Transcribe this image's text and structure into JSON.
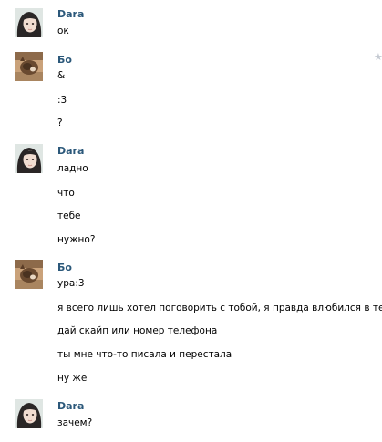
{
  "messages": [
    {
      "author": "Dara",
      "avatar": "girl-avatar-icon",
      "lines": [
        "ок"
      ]
    },
    {
      "author": "Бо",
      "avatar": "cat-avatar-icon",
      "lines": [
        "&",
        ":3",
        "?"
      ]
    },
    {
      "author": "Dara",
      "avatar": "girl-avatar-icon",
      "lines": [
        "ладно",
        "что",
        "тебе",
        "нужно?"
      ]
    },
    {
      "author": "Бо",
      "avatar": "cat-avatar-icon",
      "lines": [
        "ура:3",
        "я всего лишь хотел поговорить с тобой, я правда влюбился в тебя",
        "дай скайп или номер телефона",
        "ты мне что-то писала и перестала",
        "ну же"
      ]
    },
    {
      "author": "Dara",
      "avatar": "girl-avatar-icon",
      "lines": [
        "зачем?"
      ]
    }
  ],
  "icons": {
    "favorite": "star-icon"
  },
  "colors": {
    "author": "#2b587a",
    "text": "#000000",
    "star": "#c4c9d1"
  }
}
